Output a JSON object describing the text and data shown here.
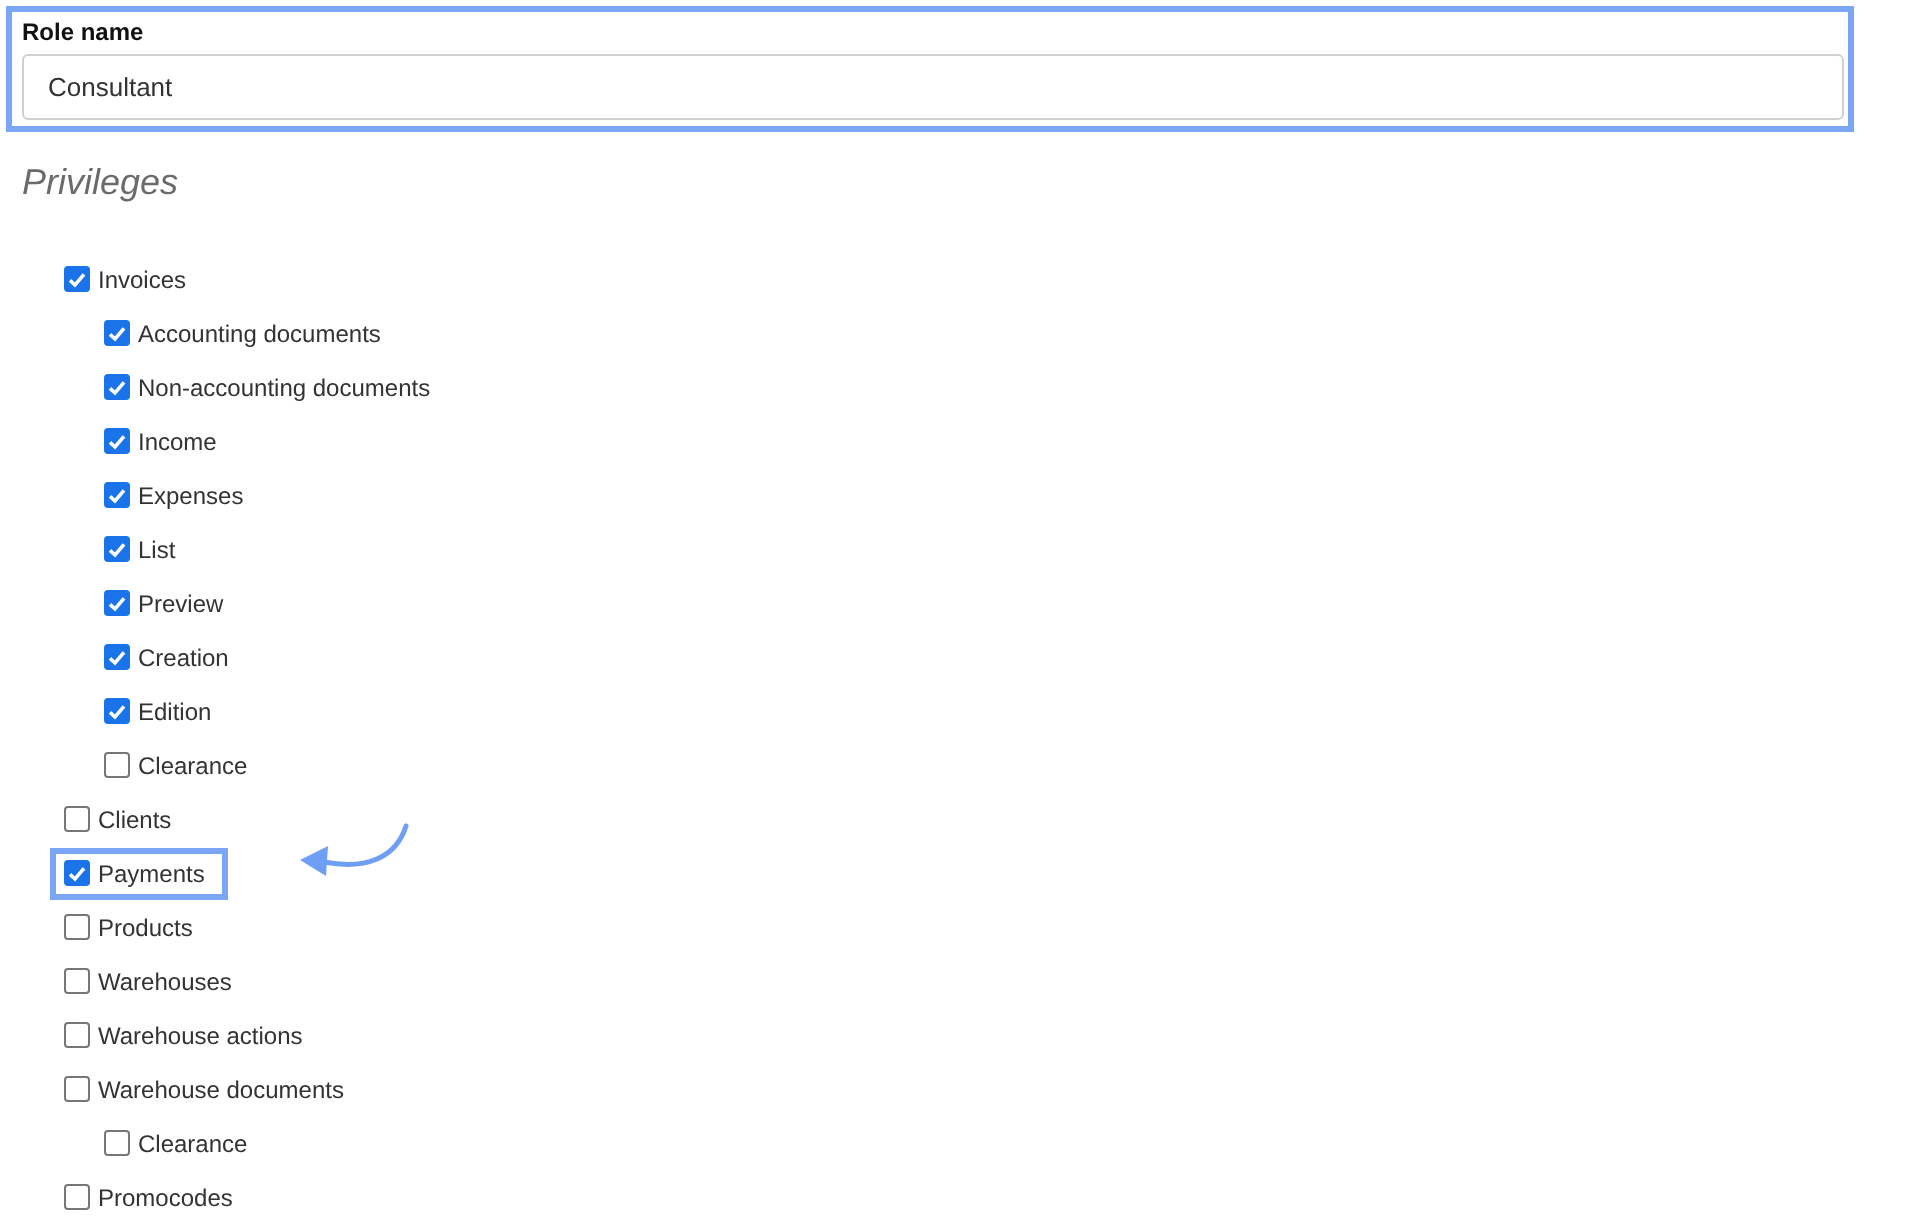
{
  "role_name": {
    "label": "Role name",
    "value": "Consultant",
    "highlighted": true
  },
  "privileges_title": "Privileges",
  "privileges": [
    {
      "label": "Invoices",
      "checked": true,
      "highlighted": false,
      "children": [
        {
          "label": "Accounting documents",
          "checked": true
        },
        {
          "label": "Non-accounting documents",
          "checked": true
        },
        {
          "label": "Income",
          "checked": true
        },
        {
          "label": "Expenses",
          "checked": true
        },
        {
          "label": "List",
          "checked": true
        },
        {
          "label": "Preview",
          "checked": true
        },
        {
          "label": "Creation",
          "checked": true
        },
        {
          "label": "Edition",
          "checked": true
        },
        {
          "label": "Clearance",
          "checked": false
        }
      ]
    },
    {
      "label": "Clients",
      "checked": false,
      "highlighted": false
    },
    {
      "label": "Payments",
      "checked": true,
      "highlighted": true
    },
    {
      "label": "Products",
      "checked": false,
      "highlighted": false
    },
    {
      "label": "Warehouses",
      "checked": false,
      "highlighted": false
    },
    {
      "label": "Warehouse actions",
      "checked": false,
      "highlighted": false
    },
    {
      "label": "Warehouse documents",
      "checked": false,
      "highlighted": false,
      "children": [
        {
          "label": "Clearance",
          "checked": false
        }
      ]
    },
    {
      "label": "Promocodes",
      "checked": false,
      "highlighted": false
    }
  ]
}
